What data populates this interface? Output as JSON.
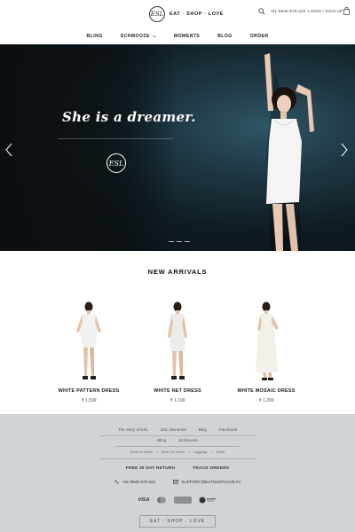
{
  "header": {
    "logo_mark": "ESL",
    "logo_text": "EAT · SHOP · LOVE",
    "phone": "+91-9845-879-322",
    "login": "LOGIN / SIGN UP"
  },
  "nav": {
    "items": [
      {
        "label": "BLING"
      },
      {
        "label": "SCHMOOZE"
      },
      {
        "label": "MOMENTS"
      },
      {
        "label": "BLOG"
      },
      {
        "label": "ORDER"
      }
    ]
  },
  "hero": {
    "headline": "She is a dreamer.",
    "logo_mark": "ESL"
  },
  "new_arrivals": {
    "title": "NEW ARRIVALS",
    "products": [
      {
        "name": "WHITE PATTERN DRESS",
        "price": "₹ 1,599"
      },
      {
        "name": "WHITE NET DRESS",
        "price": "₹ 1,199"
      },
      {
        "name": "WHITE MOSAIC DRESS",
        "price": "₹ 1,299"
      }
    ]
  },
  "footer": {
    "links_row1": [
      "The story of ESL",
      "ESL Moments",
      "Blog",
      "Facebook"
    ],
    "links_row2": [
      "Bling",
      "Schmooze"
    ],
    "links_row3": [
      "Dress In White",
      "Beat The Blues",
      "Leggings",
      "Skirts"
    ],
    "policies": [
      "FREE 30 DAY RETURN",
      "TRACK ORDERS"
    ],
    "phone": "+91-9845-879-322",
    "email": "SUPPORT@EATSHOPLOVE.IN",
    "payment": {
      "visa": "VISA"
    },
    "brand": "EAT · SHOP · LOVE"
  }
}
